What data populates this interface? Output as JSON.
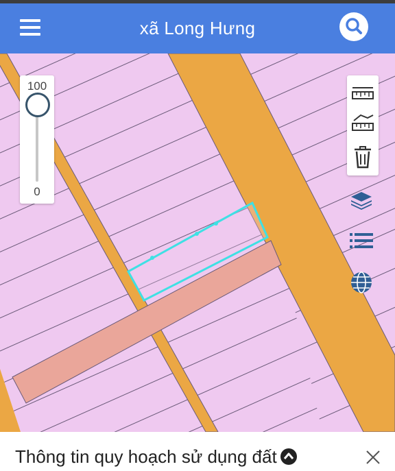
{
  "header": {
    "title": "xã Long Hưng",
    "menu_icon": "hamburger-menu-icon",
    "search_icon": "search-icon"
  },
  "zoom": {
    "max_label": "100",
    "min_label": "0",
    "level": 100
  },
  "tools": [
    {
      "name": "measure-distance-icon"
    },
    {
      "name": "measure-area-icon"
    },
    {
      "name": "trash-icon"
    }
  ],
  "side_buttons": [
    {
      "name": "layers-icon"
    },
    {
      "name": "list-icon"
    },
    {
      "name": "globe-icon"
    }
  ],
  "footer": {
    "title": "Thông tin quy hoạch sử dụng đất",
    "expand_icon": "chevron-up-icon",
    "close_icon": "close-icon"
  },
  "colors": {
    "header": "#4a7fe0",
    "land_residential": "#efc9f0",
    "road_main": "#eba744",
    "road_secondary": "#e8a44c",
    "planned_road": "#eaa69a",
    "selection_outline": "#3fe0e4",
    "parcel_line": "#6a5a78"
  }
}
